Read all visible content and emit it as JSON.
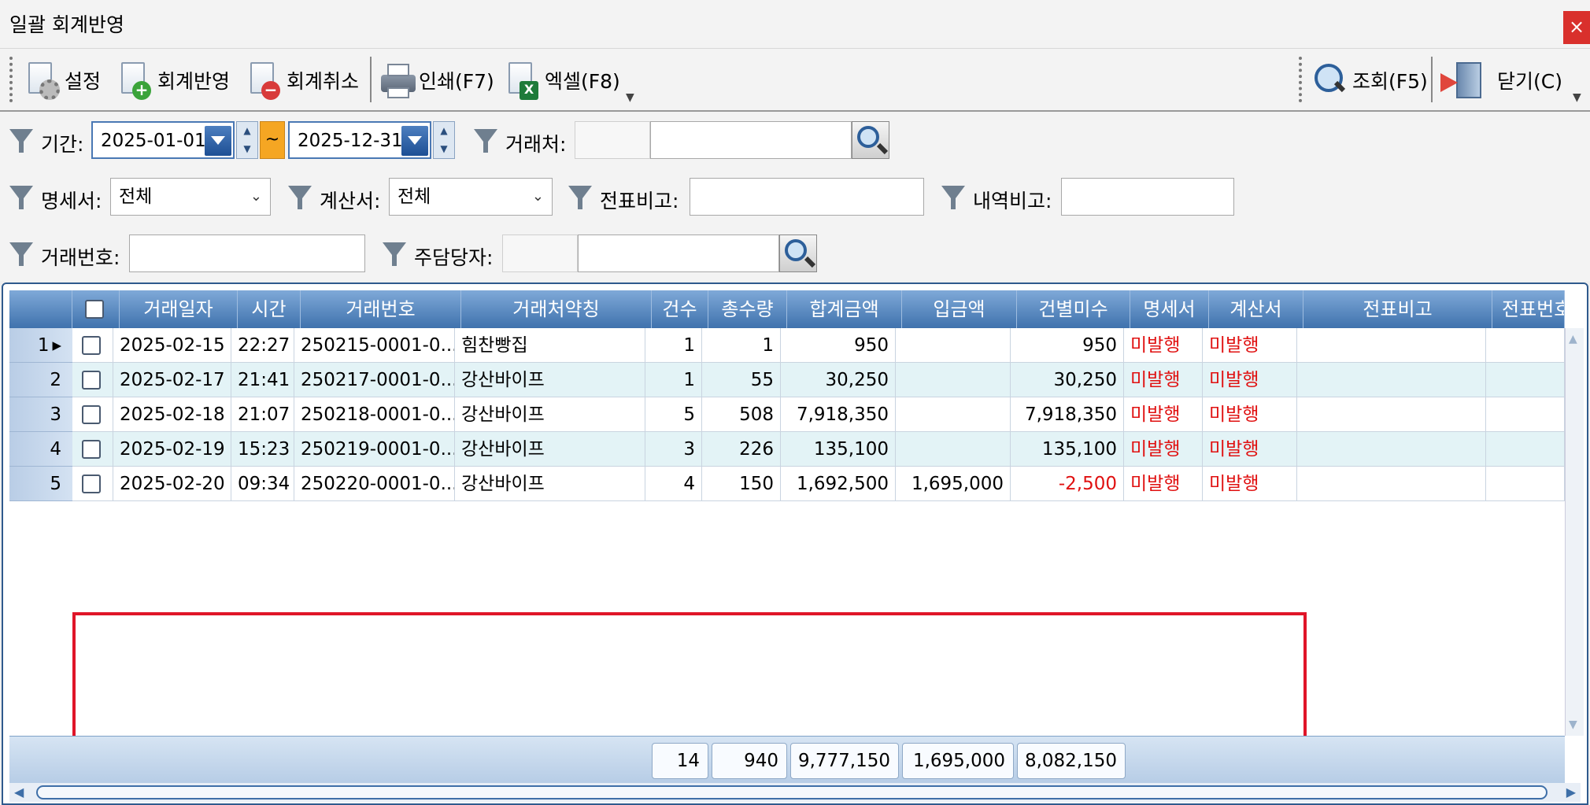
{
  "window": {
    "title": "일괄 회계반영",
    "close_glyph": "×"
  },
  "toolbar": {
    "settings_label": "설정",
    "apply_label": "회계반영",
    "cancel_label": "회계취소",
    "print_label": "인쇄(F7)",
    "excel_label": "엑셀(F8)",
    "search_label": "조회(F5)",
    "close_label": "닫기(C)"
  },
  "filters": {
    "period_label": "기간:",
    "date_from": "2025-01-01",
    "date_to": "2025-12-31",
    "range_sep": "~",
    "partner_label": "거래처:",
    "partner_code": "",
    "partner_name": "",
    "statement_label": "명세서:",
    "statement_value": "전체",
    "invoice_label": "계산서:",
    "invoice_value": "전체",
    "slip_note_label": "전표비고:",
    "slip_note_value": "",
    "detail_note_label": "내역비고:",
    "detail_note_value": "",
    "trade_no_label": "거래번호:",
    "trade_no_value": "",
    "manager_label": "주담당자:",
    "manager_code": "",
    "manager_name": ""
  },
  "grid": {
    "columns": [
      "거래일자",
      "시간",
      "거래번호",
      "거래처약칭",
      "건수",
      "총수량",
      "합계금액",
      "입금액",
      "건별미수",
      "명세서",
      "계산서",
      "전표비고",
      "전표번호"
    ],
    "rows": [
      {
        "no": "1",
        "date": "2025-02-15",
        "time": "22:27",
        "trade_no": "250215-0001-0...",
        "partner": "힘찬빵집",
        "count": "1",
        "qty": "1",
        "total": "950",
        "paid": "",
        "unpaid": "950",
        "statement": "미발행",
        "invoice": "미발행"
      },
      {
        "no": "2",
        "date": "2025-02-17",
        "time": "21:41",
        "trade_no": "250217-0001-0...",
        "partner": "강산바이프",
        "count": "1",
        "qty": "55",
        "total": "30,250",
        "paid": "",
        "unpaid": "30,250",
        "statement": "미발행",
        "invoice": "미발행"
      },
      {
        "no": "3",
        "date": "2025-02-18",
        "time": "21:07",
        "trade_no": "250218-0001-0...",
        "partner": "강산바이프",
        "count": "5",
        "qty": "508",
        "total": "7,918,350",
        "paid": "",
        "unpaid": "7,918,350",
        "statement": "미발행",
        "invoice": "미발행"
      },
      {
        "no": "4",
        "date": "2025-02-19",
        "time": "15:23",
        "trade_no": "250219-0001-0...",
        "partner": "강산바이프",
        "count": "3",
        "qty": "226",
        "total": "135,100",
        "paid": "",
        "unpaid": "135,100",
        "statement": "미발행",
        "invoice": "미발행"
      },
      {
        "no": "5",
        "date": "2025-02-20",
        "time": "09:34",
        "trade_no": "250220-0001-0...",
        "partner": "강산바이프",
        "count": "4",
        "qty": "150",
        "total": "1,692,500",
        "paid": "1,695,000",
        "unpaid": "-2,500",
        "statement": "미발행",
        "invoice": "미발행"
      }
    ],
    "totals": {
      "count": "14",
      "qty": "940",
      "total": "9,777,150",
      "paid": "1,695,000",
      "unpaid": "8,082,150"
    }
  },
  "colors": {
    "header_blue": "#3f72ad",
    "alt_row": "#e3f3f6",
    "status_red": "#e01010",
    "highlight": "#e01528"
  }
}
